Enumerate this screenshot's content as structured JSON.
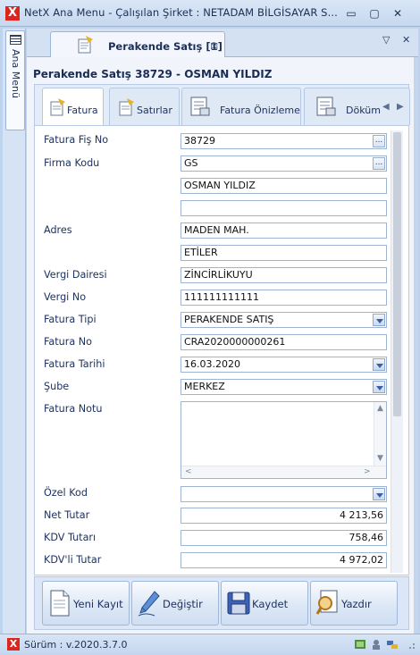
{
  "window": {
    "title": "NetX Ana Menu - Çalışılan Şirket : NETADAM BİLGİSAYAR S...",
    "logo_letter": "X",
    "minimize": "–",
    "maximize": "▢",
    "close": "✕",
    "restore_small": "▭"
  },
  "sidebar": {
    "label": "Ana Menü"
  },
  "doc_tab": {
    "label": "Perakende Satış [1]",
    "close": "⊠"
  },
  "doc_strip": {
    "dropdown": "▽",
    "close": "✕"
  },
  "form": {
    "header": "Perakende Satış  38729 - OSMAN YILDIZ",
    "tabs": [
      {
        "label": "Fatura",
        "icon": "invoice-icon",
        "active": true
      },
      {
        "label": "Satırlar",
        "icon": "lines-icon",
        "active": false
      },
      {
        "label": "Fatura Önizleme",
        "icon": "preview-icon",
        "active": false
      },
      {
        "label": "Döküm",
        "icon": "print-doc-icon",
        "active": false
      }
    ],
    "tab_scroll_left": "◀",
    "tab_scroll_right": "▶",
    "fields": {
      "fatura_fis_no": {
        "label": "Fatura Fiş No",
        "value": "38729"
      },
      "firma_kodu": {
        "label": "Firma Kodu",
        "value": "GS"
      },
      "firma_adi": {
        "value": "OSMAN YILDIZ"
      },
      "firma_ek": {
        "value": ""
      },
      "adres": {
        "label": "Adres",
        "line1": "MADEN MAH.",
        "line2": "ETİLER"
      },
      "vergi_dairesi": {
        "label": "Vergi Dairesi",
        "value": "ZİNCİRLİKUYU"
      },
      "vergi_no": {
        "label": "Vergi No",
        "value": "111111111111"
      },
      "fatura_tipi": {
        "label": "Fatura Tipi",
        "value": "PERAKENDE SATIŞ"
      },
      "fatura_no": {
        "label": "Fatura No",
        "value": "CRA2020000000261"
      },
      "fatura_tarihi": {
        "label": "Fatura Tarihi",
        "value": "16.03.2020"
      },
      "sube": {
        "label": "Şube",
        "value": "MERKEZ"
      },
      "fatura_notu": {
        "label": "Fatura Notu",
        "value": ""
      },
      "ozel_kod": {
        "label": "Özel Kod",
        "value": ""
      },
      "net_tutar": {
        "label": "Net Tutar",
        "value": "4 213,56"
      },
      "kdv_tutari": {
        "label": "KDV Tutarı",
        "value": "758,46"
      },
      "kdvli_tutar": {
        "label": "KDV'li Tutar",
        "value": "4 972,02"
      }
    },
    "ellipsis": "...",
    "memo_arrows": {
      "up": "▲",
      "down": "▼",
      "left": "<",
      "right": ">"
    }
  },
  "buttons": {
    "yeni_kayit": "Yeni Kayıt",
    "degistir": "Değiştir",
    "kaydet": "Kaydet",
    "yazdir": "Yazdır"
  },
  "status": {
    "version": "Sürüm : v.2020.3.7.0",
    "logo_letter": "X"
  },
  "colors": {
    "brand_red": "#d8271f",
    "accent_blue": "#3b5fa4",
    "frame_blue": "#bdd3ee"
  }
}
